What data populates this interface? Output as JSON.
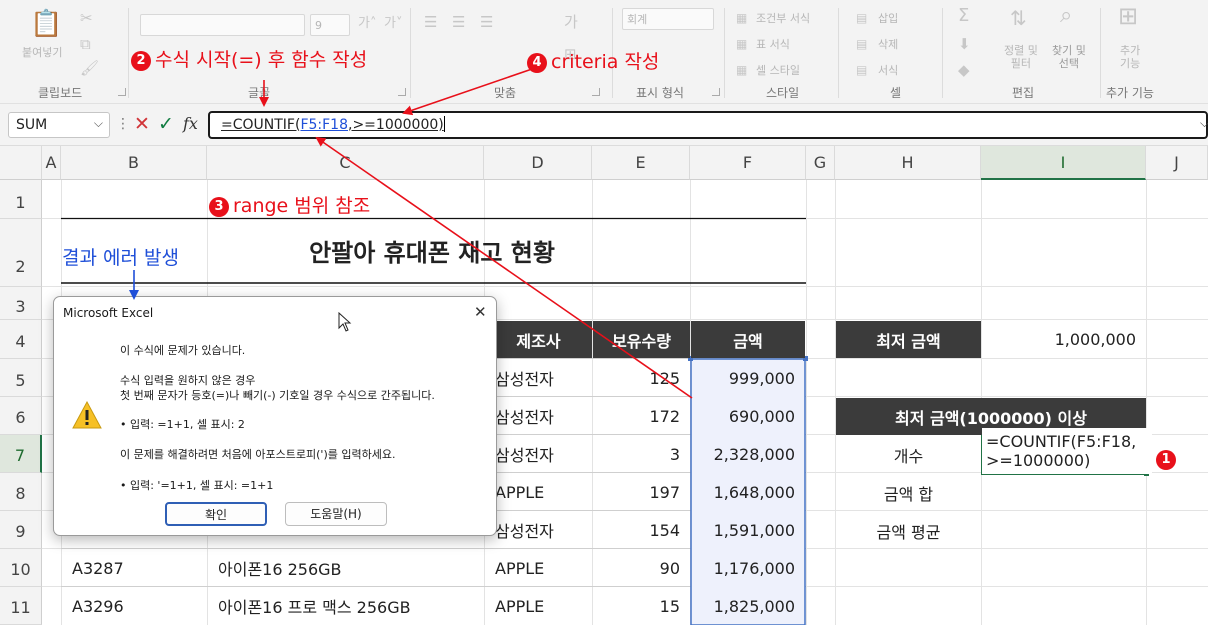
{
  "ribbon": {
    "clipboard": {
      "paste_label": "붙여넣기",
      "group_label": "클립보드"
    },
    "font": {
      "size_value": "9",
      "group_label": "글꼴"
    },
    "alignment": {
      "group_label": "맞춤"
    },
    "number": {
      "format_value": "회계",
      "group_label": "표시 형식"
    },
    "styles": {
      "conditional": "조건부 서식",
      "table": "표 서식",
      "cell": "셀 스타일",
      "group_label": "스타일"
    },
    "cells": {
      "insert": "삽입",
      "delete": "삭제",
      "format": "서식",
      "group_label": "셀"
    },
    "editing": {
      "sort_filter": "정렬 및\n필터",
      "find_select": "찾기 및\n선택",
      "group_label": "편집"
    },
    "addins": {
      "label": "추가\n기능",
      "group_label": "추가 기능"
    }
  },
  "formula_bar": {
    "name_box": "SUM",
    "fx_label": "fx",
    "formula_prefix": "=COUNTIF(",
    "formula_range": "F5:F18",
    "formula_suffix": ",>=1000000)"
  },
  "columns": [
    "A",
    "B",
    "C",
    "D",
    "E",
    "F",
    "G",
    "H",
    "I",
    "J"
  ],
  "rows": [
    "1",
    "2",
    "3",
    "4",
    "5",
    "6",
    "7",
    "8",
    "9",
    "10",
    "11"
  ],
  "sheet": {
    "title": "안팔아 휴대폰 재고 현황",
    "table_headers": {
      "manufacturer": "제조사",
      "quantity": "보유수량",
      "amount": "금액"
    },
    "table_rows": [
      {
        "code": "",
        "model": "",
        "maker": "삼성전자",
        "qty": "125",
        "amount": "999,000"
      },
      {
        "code": "",
        "model": "",
        "maker": "삼성전자",
        "qty": "172",
        "amount": "690,000"
      },
      {
        "code": "",
        "model": "",
        "maker": "삼성전자",
        "qty": "3",
        "amount": "2,328,000"
      },
      {
        "code": "",
        "model": "",
        "maker": "APPLE",
        "qty": "197",
        "amount": "1,648,000"
      },
      {
        "code": "",
        "model": "",
        "maker": "삼성전자",
        "qty": "154",
        "amount": "1,591,000"
      },
      {
        "code": "A3287",
        "model": "아이폰16 256GB",
        "maker": "APPLE",
        "qty": "90",
        "amount": "1,176,000"
      },
      {
        "code": "A3296",
        "model": "아이폰16 프로 맥스 256GB",
        "maker": "APPLE",
        "qty": "15",
        "amount": "1,825,000"
      }
    ],
    "min_label": "최저 금액",
    "min_value": "1,000,000",
    "section_header": "최저 금액(1000000) 이상",
    "count_label": "개수",
    "count_cell_line1": "=COUNTIF(F5:F18,",
    "count_cell_line2": ">=1000000)",
    "sum_label": "금액 합",
    "avg_label": "금액 평균"
  },
  "annotations": {
    "step1": "1",
    "step2_num": "2",
    "step2": "수식 시작(=) 후 함수 작성",
    "step3_num": "3",
    "step3": "range 범위 참조",
    "step4_num": "4",
    "step4": "criteria 작성",
    "error_note": "결과 에러 발생",
    "colors": {
      "red": "#e8101a",
      "blue": "#1f4fd8"
    }
  },
  "dialog": {
    "title": "Microsoft Excel",
    "line1": "이 수식에 문제가 있습니다.",
    "line2": "수식 입력을 원하지 않은 경우",
    "line3": "첫 번째 문자가 등호(=)나 빼기(-) 기호일 경우 수식으로 간주됩니다.",
    "line4": "• 입력:   =1+1, 셀 표시:   2",
    "line5": "이 문제를 해결하려면 처음에 아포스트로피(')를 입력하세요.",
    "line6": "• 입력:   '=1+1, 셀 표시:   =1+1",
    "ok_button": "확인",
    "help_button": "도움말(H)",
    "icon": "warning-icon"
  }
}
